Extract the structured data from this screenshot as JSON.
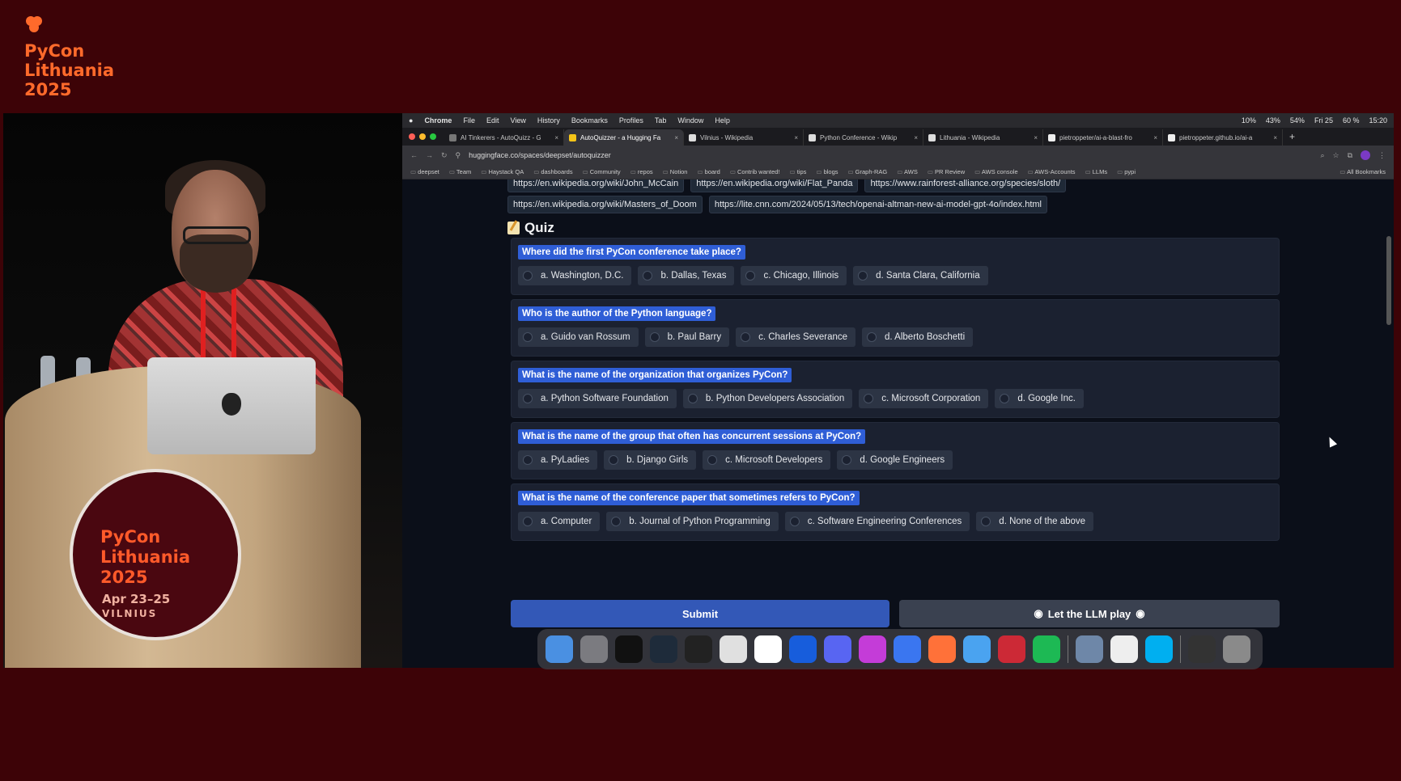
{
  "brand": {
    "line1": "PyCon",
    "line2": "Lithuania",
    "line3": "2025",
    "color": "#ff6a2b"
  },
  "podium_badge": {
    "line1": "PyCon",
    "line2": "Lithuania",
    "line3": "2025",
    "dates": "Apr 23–25",
    "city": "VILNIUS"
  },
  "menubar": {
    "app": "Chrome",
    "items": [
      "File",
      "Edit",
      "View",
      "History",
      "Bookmarks",
      "Profiles",
      "Tab",
      "Window",
      "Help"
    ],
    "status": [
      "10%",
      "43%",
      "54%",
      "Fri 25",
      "60 %",
      "15:20"
    ]
  },
  "tabs": [
    {
      "label": "AI Tinkerers - AutoQuizz - G",
      "active": false
    },
    {
      "label": "AutoQuizzer - a Hugging Fa",
      "active": true
    },
    {
      "label": "Vilnius - Wikipedia",
      "active": false
    },
    {
      "label": "Python Conference - Wikip",
      "active": false
    },
    {
      "label": "Lithuania - Wikipedia",
      "active": false
    },
    {
      "label": "pietroppeter/ai-a-blast-fro",
      "active": false
    },
    {
      "label": "pietroppeter.github.io/ai-a",
      "active": false
    }
  ],
  "url": "huggingface.co/spaces/deepset/autoquizzer",
  "bookmarks": [
    "deepset",
    "Team",
    "Haystack QA",
    "dashboards",
    "Community",
    "repos",
    "Notion",
    "board",
    "Contrib wanted!",
    "tips",
    "blogs",
    "Graph-RAG",
    "AWS",
    "PR Review",
    "AWS console",
    "AWS-Accounts",
    "LLMs",
    "pypi",
    "All Bookmarks"
  ],
  "links": {
    "row1": [
      "https://en.wikipedia.org/wiki/John_McCain",
      "https://en.wikipedia.org/wiki/Flat_Panda",
      "https://www.rainforest-alliance.org/species/sloth/"
    ],
    "row2": [
      "https://en.wikipedia.org/wiki/Masters_of_Doom",
      "https://lite.cnn.com/2024/05/13/tech/openai-altman-new-ai-model-gpt-4o/index.html"
    ]
  },
  "quiz": {
    "title": "Quiz",
    "questions": [
      {
        "question": "Where did the first PyCon conference take place?",
        "options": [
          "a. Washington, D.C.",
          "b. Dallas, Texas",
          "c. Chicago, Illinois",
          "d. Santa Clara, California"
        ]
      },
      {
        "question": "Who is the author of the Python language?",
        "options": [
          "a. Guido van Rossum",
          "b. Paul Barry",
          "c. Charles Severance",
          "d. Alberto Boschetti"
        ]
      },
      {
        "question": "What is the name of the organization that organizes PyCon?",
        "options": [
          "a. Python Software Foundation",
          "b. Python Developers Association",
          "c. Microsoft Corporation",
          "d. Google Inc."
        ]
      },
      {
        "question": "What is the name of the group that often has concurrent sessions at PyCon?",
        "options": [
          "a. PyLadies",
          "b. Django Girls",
          "c. Microsoft Developers",
          "d. Google Engineers"
        ]
      },
      {
        "question": "What is the name of the conference paper that sometimes refers to PyCon?",
        "options": [
          "a. Computer",
          "b. Journal of Python Programming",
          "c. Software Engineering Conferences",
          "d. None of the above"
        ]
      }
    ],
    "submit_label": "Submit",
    "llm_label": "Let the LLM play"
  },
  "dock": [
    {
      "icon": "finder-icon",
      "color": "#4a90e2"
    },
    {
      "icon": "system-settings-icon",
      "color": "#7b7b80"
    },
    {
      "icon": "terminal-icon",
      "color": "#111111"
    },
    {
      "icon": "pycharm-icon",
      "color": "#1e2b3a"
    },
    {
      "icon": "unity-icon",
      "color": "#222222"
    },
    {
      "icon": "chrome-icon",
      "color": "#e0e0e0"
    },
    {
      "icon": "slack-icon",
      "color": "#ffffff"
    },
    {
      "icon": "bitwarden-icon",
      "color": "#175ddc"
    },
    {
      "icon": "discord-icon",
      "color": "#5865f2"
    },
    {
      "icon": "flower-app-icon",
      "color": "#c43cd8"
    },
    {
      "icon": "signal-icon",
      "color": "#3a76f0"
    },
    {
      "icon": "firefox-icon",
      "color": "#ff7139"
    },
    {
      "icon": "safari-icon",
      "color": "#4aa3f0"
    },
    {
      "icon": "zotero-icon",
      "color": "#cc2936"
    },
    {
      "icon": "spotify-icon",
      "color": "#1db954"
    },
    {
      "icon": "preview-icon",
      "color": "#6e87a8"
    },
    {
      "icon": "cat-app-icon",
      "color": "#eeeeee"
    },
    {
      "icon": "skype-icon",
      "color": "#00aff0"
    },
    {
      "icon": "downloads-icon",
      "color": "#333333"
    },
    {
      "icon": "trash-icon",
      "color": "#8a8a8a"
    }
  ]
}
